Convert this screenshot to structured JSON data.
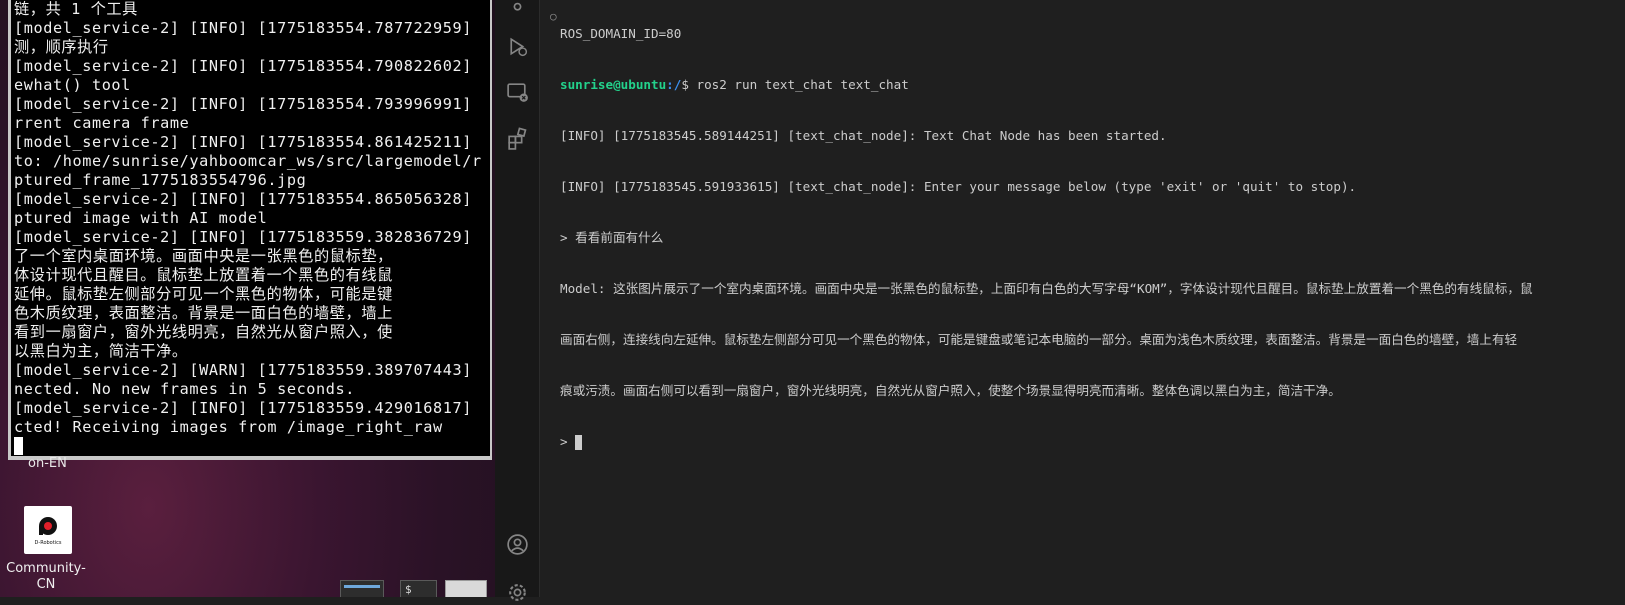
{
  "desktop": {
    "terminal_lines": [
      "链，共 1 个工具",
      "[model_service-2] [INFO] [1775183554.787722959]",
      "测，顺序执行",
      "[model_service-2] [INFO] [1775183554.790822602]",
      "ewhat() tool",
      "[model_service-2] [INFO] [1775183554.793996991]",
      "rrent camera frame",
      "[model_service-2] [INFO] [1775183554.861425211]",
      "to: /home/sunrise/yahboomcar_ws/src/largemodel/r",
      "ptured_frame_1775183554796.jpg",
      "[model_service-2] [INFO] [1775183554.865056328]",
      "ptured image with AI model",
      "[model_service-2] [INFO] [1775183559.382836729]",
      "了一个室内桌面环境。画面中央是一张黑色的鼠标垫，",
      "体设计现代且醒目。鼠标垫上放置着一个黑色的有线鼠",
      "延伸。鼠标垫左侧部分可见一个黑色的物体，可能是键",
      "色木质纹理，表面整洁。背景是一面白色的墙壁，墙上",
      "看到一扇窗户，窗外光线明亮，自然光从窗户照入，使",
      "以黑白为主，简洁干净。",
      "[model_service-2] [WARN] [1775183559.389707443]",
      "nected. No new frames in 5 seconds.",
      "[model_service-2] [INFO] [1775183559.429016817]",
      "cted! Receiving images from /image_right_raw"
    ],
    "icon_label_top": "on-EN",
    "app_icon_label_line1": "Community-",
    "app_icon_label_line2": "CN",
    "app_icon_logo_text": "D-Robotics"
  },
  "vscode": {
    "activity_icons": [
      "source-control-icon",
      "run-debug-icon",
      "remote-explorer-icon",
      "extensions-icon",
      "account-icon",
      "settings-gear-icon"
    ],
    "terminal": {
      "top_partial": "ROS_DOMAIN_ID=80",
      "prompt_user": "sunrise@ubuntu",
      "prompt_path": ":/",
      "prompt_symbol": "$ ",
      "command": "ros2 run text_chat text_chat",
      "lines": [
        "[INFO] [1775183545.589144251] [text_chat_node]: Text Chat Node has been started.",
        "[INFO] [1775183545.591933615] [text_chat_node]: Enter your message below (type 'exit' or 'quit' to stop).",
        "> 看看前面有什么",
        "Model: 这张图片展示了一个室内桌面环境。画面中央是一张黑色的鼠标垫，上面印有白色的大写字母“KOM”，字体设计现代且醒目。鼠标垫上放置着一个黑色的有线鼠标，鼠",
        "画面右侧，连接线向左延伸。鼠标垫左侧部分可见一个黑色的物体，可能是键盘或笔记本电脑的一部分。桌面为浅色木质纹理，表面整洁。背景是一面白色的墙壁，墙上有轻",
        "痕或污渍。画面右侧可以看到一扇窗户，窗外光线明亮，自然光从窗户照入，使整个场景显得明亮而清晰。整体色调以黑白为主，简洁干净。"
      ],
      "input_prompt": "> "
    }
  },
  "colors": {
    "prompt_user": "#23d18b",
    "prompt_path": "#3b8eea",
    "panel_bg": "#1f1f1f"
  }
}
